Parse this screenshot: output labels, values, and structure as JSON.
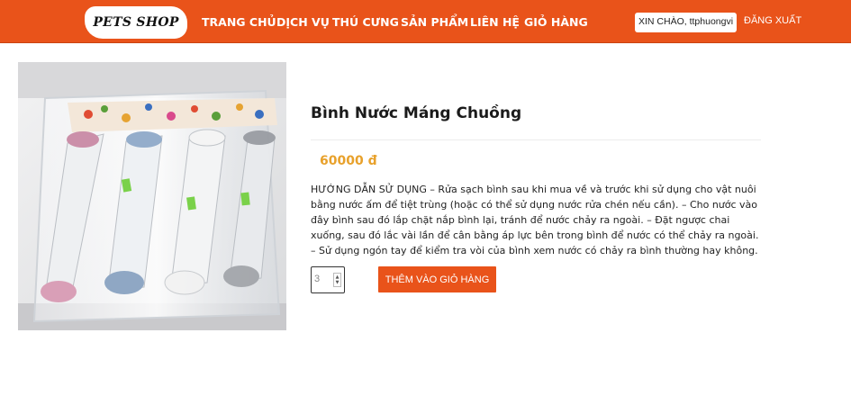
{
  "header": {
    "logo": "PETS SHOP",
    "nav": [
      "TRANG CHỦ",
      "DỊCH VỤ",
      "THÚ CƯNG",
      "SẢN PHẨM",
      "LIÊN HỆ",
      "GIỎ HÀNG"
    ],
    "greeting": "XIN CHÀO, ttphuongvi",
    "logout": "ĐĂNG XUẤT"
  },
  "product": {
    "name": "Bình Nước Máng Chuồng",
    "price": "60000 đ",
    "description": "HƯỚNG DẪN SỬ DỤNG – Rửa sạch bình sau khi mua về và trước khi sử dụng cho vật nuôi bằng nước ấm để tiệt trùng (hoặc có thể sử dụng nước rửa chén nếu cần). – Cho nước vào đây bình sau đó lắp chặt nắp bình lại, tránh để nước chảy ra ngoài. – Đặt ngược chai xuống, sau đó lắc vài lần để cân bằng áp lực bên trong bình để nước có thể chảy ra ngoài. – Sử dụng ngón tay để kiểm tra vòi của bình xem nước có chảy ra bình thường hay không.",
    "quantity": "3",
    "add_to_cart": "THÊM VÀO GIỎ HÀNG"
  },
  "colors": {
    "brand": "#e9531a",
    "price": "#e8a12b"
  }
}
